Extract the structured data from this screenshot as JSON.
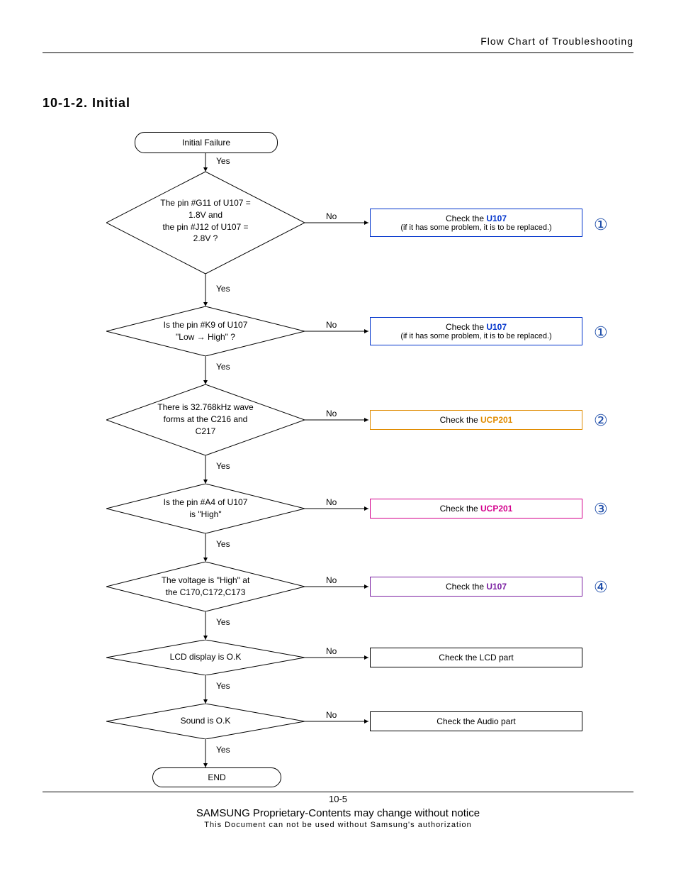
{
  "header": {
    "title": "Flow Chart of Troubleshooting"
  },
  "section": {
    "title": "10-1-2. Initial"
  },
  "nodes": {
    "start": "Initial Failure",
    "d1_l1": "The pin #G11 of U107 =",
    "d1_l2": "1.8V and",
    "d1_l3": "the pin #J12 of U107 =",
    "d1_l4": "2.8V ?",
    "d2_l1": "Is the pin #K9 of U107",
    "d2_l2": "\"Low → High\" ?",
    "d3_l1": "There is 32.768kHz wave",
    "d3_l2": "forms at the C216 and",
    "d3_l3": "C217",
    "d4_l1": "Is the pin #A4 of U107",
    "d4_l2": "is \"High\"",
    "d5_l1": "The voltage is \"High\" at",
    "d5_l2": "the C170,C172,C173",
    "d6": "LCD display is O.K",
    "d7": "Sound is O.K",
    "end": "END"
  },
  "actions": {
    "a1_pre": "Check the ",
    "a1_comp": "U107",
    "a1_sub": "(if it has some problem, it is to be replaced.)",
    "a2_pre": "Check the ",
    "a2_comp": "U107",
    "a2_sub": "(if it has some problem, it is to be replaced.)",
    "a3_pre": "Check the ",
    "a3_comp": "UCP201",
    "a4_pre": "Check the ",
    "a4_comp": "UCP201",
    "a5_pre": "Check the ",
    "a5_comp": "U107",
    "a6": "Check the LCD part",
    "a7": "Check the Audio part"
  },
  "labels": {
    "yes": "Yes",
    "no": "No"
  },
  "markers": {
    "m1": "①",
    "m2": "②",
    "m3": "③",
    "m4": "④"
  },
  "footer": {
    "page": "10-5",
    "prop": "SAMSUNG Proprietary-Contents may change without notice",
    "auth": "This Document can not be used without Samsung's authorization"
  }
}
